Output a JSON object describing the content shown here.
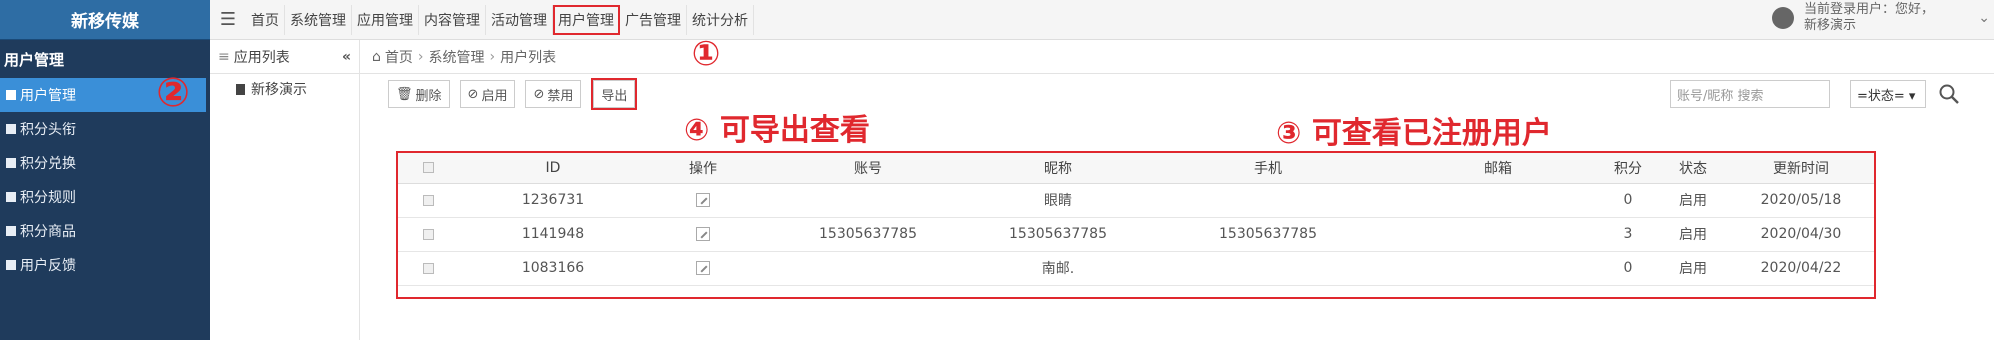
{
  "brand": "新移传媒",
  "sidebar": {
    "section": "用户管理",
    "items": [
      {
        "label": "用户管理",
        "active": true
      },
      {
        "label": "积分头衔"
      },
      {
        "label": "积分兑换"
      },
      {
        "label": "积分规则"
      },
      {
        "label": "积分商品"
      },
      {
        "label": "用户反馈"
      }
    ]
  },
  "topnav": [
    "首页",
    "系统管理",
    "应用管理",
    "内容管理",
    "活动管理",
    "用户管理",
    "广告管理",
    "统计分析"
  ],
  "user": {
    "line1": "当前登录用户：您好，",
    "line2": "新移演示"
  },
  "applist": {
    "title": "应用列表",
    "collapse": "«",
    "items": [
      "新移演示"
    ]
  },
  "breadcrumb": [
    "首页",
    "系统管理",
    "用户列表"
  ],
  "toolbar": {
    "delete": "删除",
    "enable": "启用",
    "disable": "禁用",
    "export": "导出"
  },
  "search": {
    "placeholder": "账号/昵称 搜索",
    "status": "=状态= ▾"
  },
  "table": {
    "headers": [
      "ID",
      "操作",
      "账号",
      "昵称",
      "手机",
      "邮箱",
      "积分",
      "状态",
      "更新时间"
    ],
    "rows": [
      {
        "id": "1236731",
        "account": "",
        "nick": "眼睛",
        "phone": "",
        "email": "",
        "points": "0",
        "status": "启用",
        "updated": "2020/05/18"
      },
      {
        "id": "1141948",
        "account": "15305637785",
        "nick": "15305637785",
        "phone": "15305637785",
        "email": "",
        "points": "3",
        "status": "启用",
        "updated": "2020/04/30"
      },
      {
        "id": "1083166",
        "account": "",
        "nick": "南邮.",
        "phone": "",
        "email": "",
        "points": "0",
        "status": "启用",
        "updated": "2020/04/22"
      }
    ]
  },
  "annotations": {
    "n1": "①",
    "n2": "②",
    "export_note": "④ 可导出查看",
    "users_note": "③ 可查看已注册用户"
  },
  "colors": {
    "sidebar": "#1f3b5c",
    "brand": "#2e6da4",
    "active": "#3a8fd8",
    "annotation": "#e0282e"
  }
}
